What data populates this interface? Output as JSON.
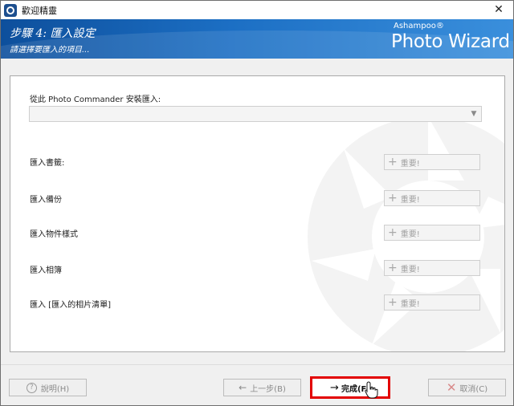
{
  "window": {
    "title": "歡迎精靈",
    "close_glyph": "✕"
  },
  "header": {
    "step_title": "步驟 4: 匯入設定",
    "step_subtitle": "請選擇要匯入的項目...",
    "brand_company": "Ashampoo®",
    "brand_product": "Photo Wizard",
    "gradient_colors": [
      "#0d4f9c",
      "#3a8fdc"
    ]
  },
  "form": {
    "source_label": "從此 Photo Commander 安裝匯入:",
    "source_value": "",
    "rows": [
      {
        "label": "匯入書籤:",
        "button": "重要!"
      },
      {
        "label": "匯入備份",
        "button": "重要!"
      },
      {
        "label": "匯入物件樣式",
        "button": "重要!"
      },
      {
        "label": "匯入相簿",
        "button": "重要!"
      },
      {
        "label": "匯入 [匯入的相片清單]",
        "button": "重要!"
      }
    ]
  },
  "footer": {
    "help": "說明(H)",
    "back": "上一步(B)",
    "finish": "完成(F)",
    "cancel": "取消(C)",
    "highlight_color": "#e30000"
  },
  "icons": {
    "app": "app-logo-icon",
    "plus": "plus-icon",
    "help": "help-icon",
    "back": "arrow-left-icon",
    "finish": "arrow-right-icon",
    "cancel": "close-icon",
    "cursor": "hand-cursor-icon"
  }
}
